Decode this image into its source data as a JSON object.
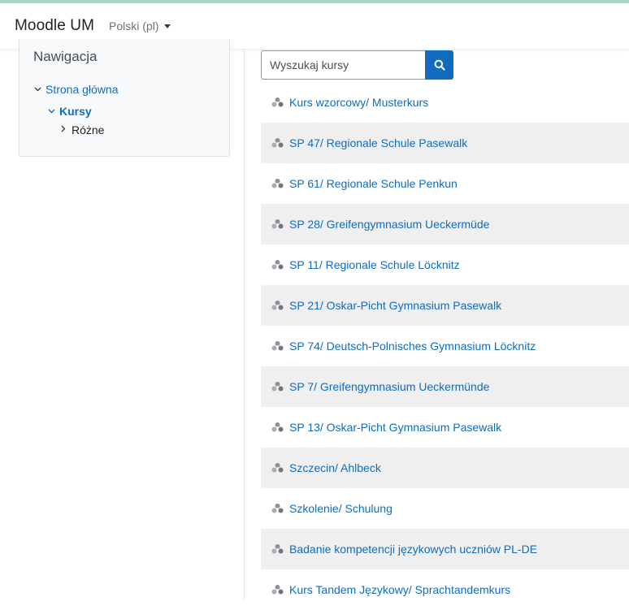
{
  "header": {
    "brand": "Moodle UM",
    "language": "Polski (pl)"
  },
  "navigation": {
    "title": "Nawigacja",
    "items": [
      {
        "label": "Strona główna",
        "chevron": "expanded"
      },
      {
        "label": "Kursy",
        "chevron": "expanded"
      },
      {
        "label": "Różne",
        "chevron": "collapsed"
      }
    ]
  },
  "search": {
    "placeholder": "Wyszukaj kursy",
    "icon": "search-icon"
  },
  "courses": [
    "Kurs wzorcowy/ Musterkurs",
    "SP 47/ Regionale Schule Pasewalk",
    "SP 61/ Regionale Schule Penkun",
    "SP 28/ Greifengymnasium Ueckermüde",
    "SP 11/ Regionale Schule Löcknitz",
    "SP 21/ Oskar-Picht Gymnasium Pasewalk",
    "SP 74/ Deutsch-Polnisches Gymnasium Löcknitz",
    "SP 7/ Greifengymnasium Ueckermünde",
    "SP 13/ Oskar-Picht Gymnasium Pasewalk",
    "Szczecin/ Ahlbeck",
    "Szkolenie/ Schulung",
    "Badanie kompetencji językowych uczniów PL-DE",
    "Kurs Tandem Językowy/ Sprachtandemkurs"
  ],
  "colors": {
    "accent": "#0f6cbf",
    "top_bar": "#a9d5cd",
    "row_alt": "#efefef"
  }
}
